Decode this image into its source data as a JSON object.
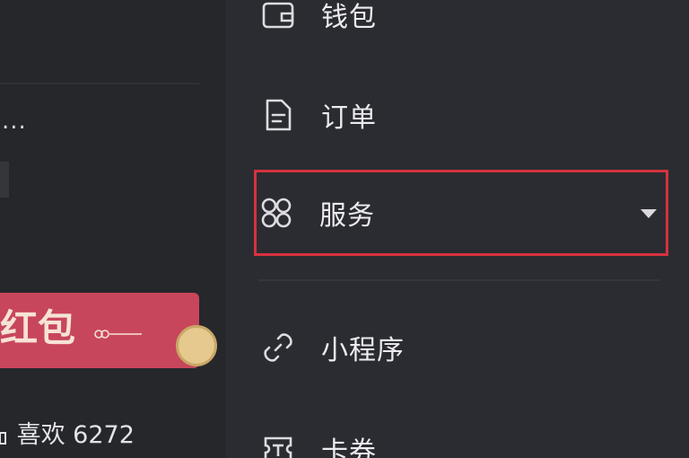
{
  "left_panel": {
    "ellipsis": "...",
    "redpacket_text": "红包",
    "likes_text": "喜欢 6272"
  },
  "menu": {
    "items": [
      {
        "id": "wallet",
        "label": "钱包",
        "icon": "wallet-icon"
      },
      {
        "id": "orders",
        "label": "订单",
        "icon": "document-icon"
      },
      {
        "id": "services",
        "label": "服务",
        "icon": "grid-apps-icon",
        "selected": true,
        "expand_icon": "caret-down-icon"
      },
      {
        "id": "mini_programs",
        "label": "小程序",
        "icon": "link-icon"
      },
      {
        "id": "coupons",
        "label": "卡券",
        "icon": "ticket-icon"
      }
    ]
  },
  "colors": {
    "background": "#2b2c31",
    "highlight_border": "#d6323f",
    "redpacket": "#c8465b"
  }
}
